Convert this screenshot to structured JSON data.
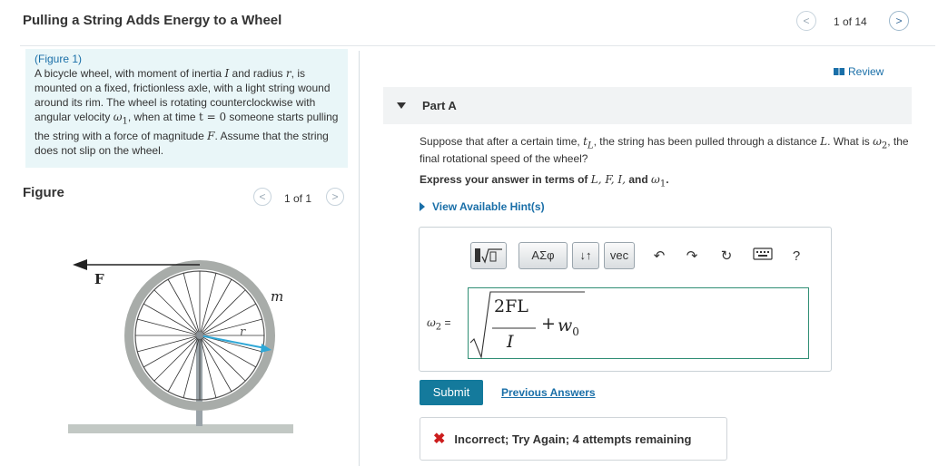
{
  "header": {
    "title": "Pulling a String Adds Energy to a Wheel",
    "prev_icon": "chevron-left",
    "next_icon": "chevron-right",
    "page_counter": "1 of 14"
  },
  "intro": {
    "figure_link": "(Figure 1)",
    "t1": "A bicycle wheel, with moment of inertia ",
    "I": "I",
    "t2": " and radius ",
    "r": "r",
    "t3": ", is mounted on a fixed, frictionless axle, with a light string wound around its rim. The wheel is rotating counterclockwise with angular velocity ",
    "w1": "ω",
    "w1_sub": "1",
    "t4": ", when at time ",
    "t_eq": "t = 0",
    "t5": " someone starts pulling the string with a force of magnitude ",
    "F": "F",
    "t6": ". Assume that the string does not slip on the wheel."
  },
  "figure": {
    "heading": "Figure",
    "counter": "1 of 1",
    "label_F": "F",
    "label_m": "m",
    "label_r": "r"
  },
  "review": {
    "label": "Review"
  },
  "part": {
    "label": "Part A",
    "q1": "Suppose that after a certain time, ",
    "tL": "t",
    "tL_sub": "L",
    "q2": ", the string has been pulled through a distance ",
    "L": "L",
    "q3": ". What is ",
    "w2": "ω",
    "w2_sub": "2",
    "q4": ", the final rotational speed of the wheel?",
    "express_prefix": "Express your answer in terms of ",
    "express_vars": "L, F, I,",
    "express_and": " and ",
    "express_w": "ω",
    "express_w_sub": "1",
    "express_suffix": ".",
    "hint": "View Available Hint(s)"
  },
  "toolbar": {
    "templates_icon": "templates-icon",
    "greek": "ΑΣφ",
    "arrows": "↓↑",
    "vec": "vec",
    "undo": "↶",
    "redo": "↷",
    "reset": "↻",
    "keyboard_icon": "keyboard-icon",
    "help": "?"
  },
  "answer": {
    "label_w": "ω",
    "label_sub": "2",
    "label_eq": " =",
    "numerator": "2FL",
    "denominator": "I",
    "plus": "+",
    "w": "w",
    "w_sub": "0"
  },
  "actions": {
    "submit": "Submit",
    "previous_answers": "Previous Answers"
  },
  "feedback": {
    "icon": "✖",
    "message": "Incorrect; Try Again; 4 attempts remaining"
  }
}
